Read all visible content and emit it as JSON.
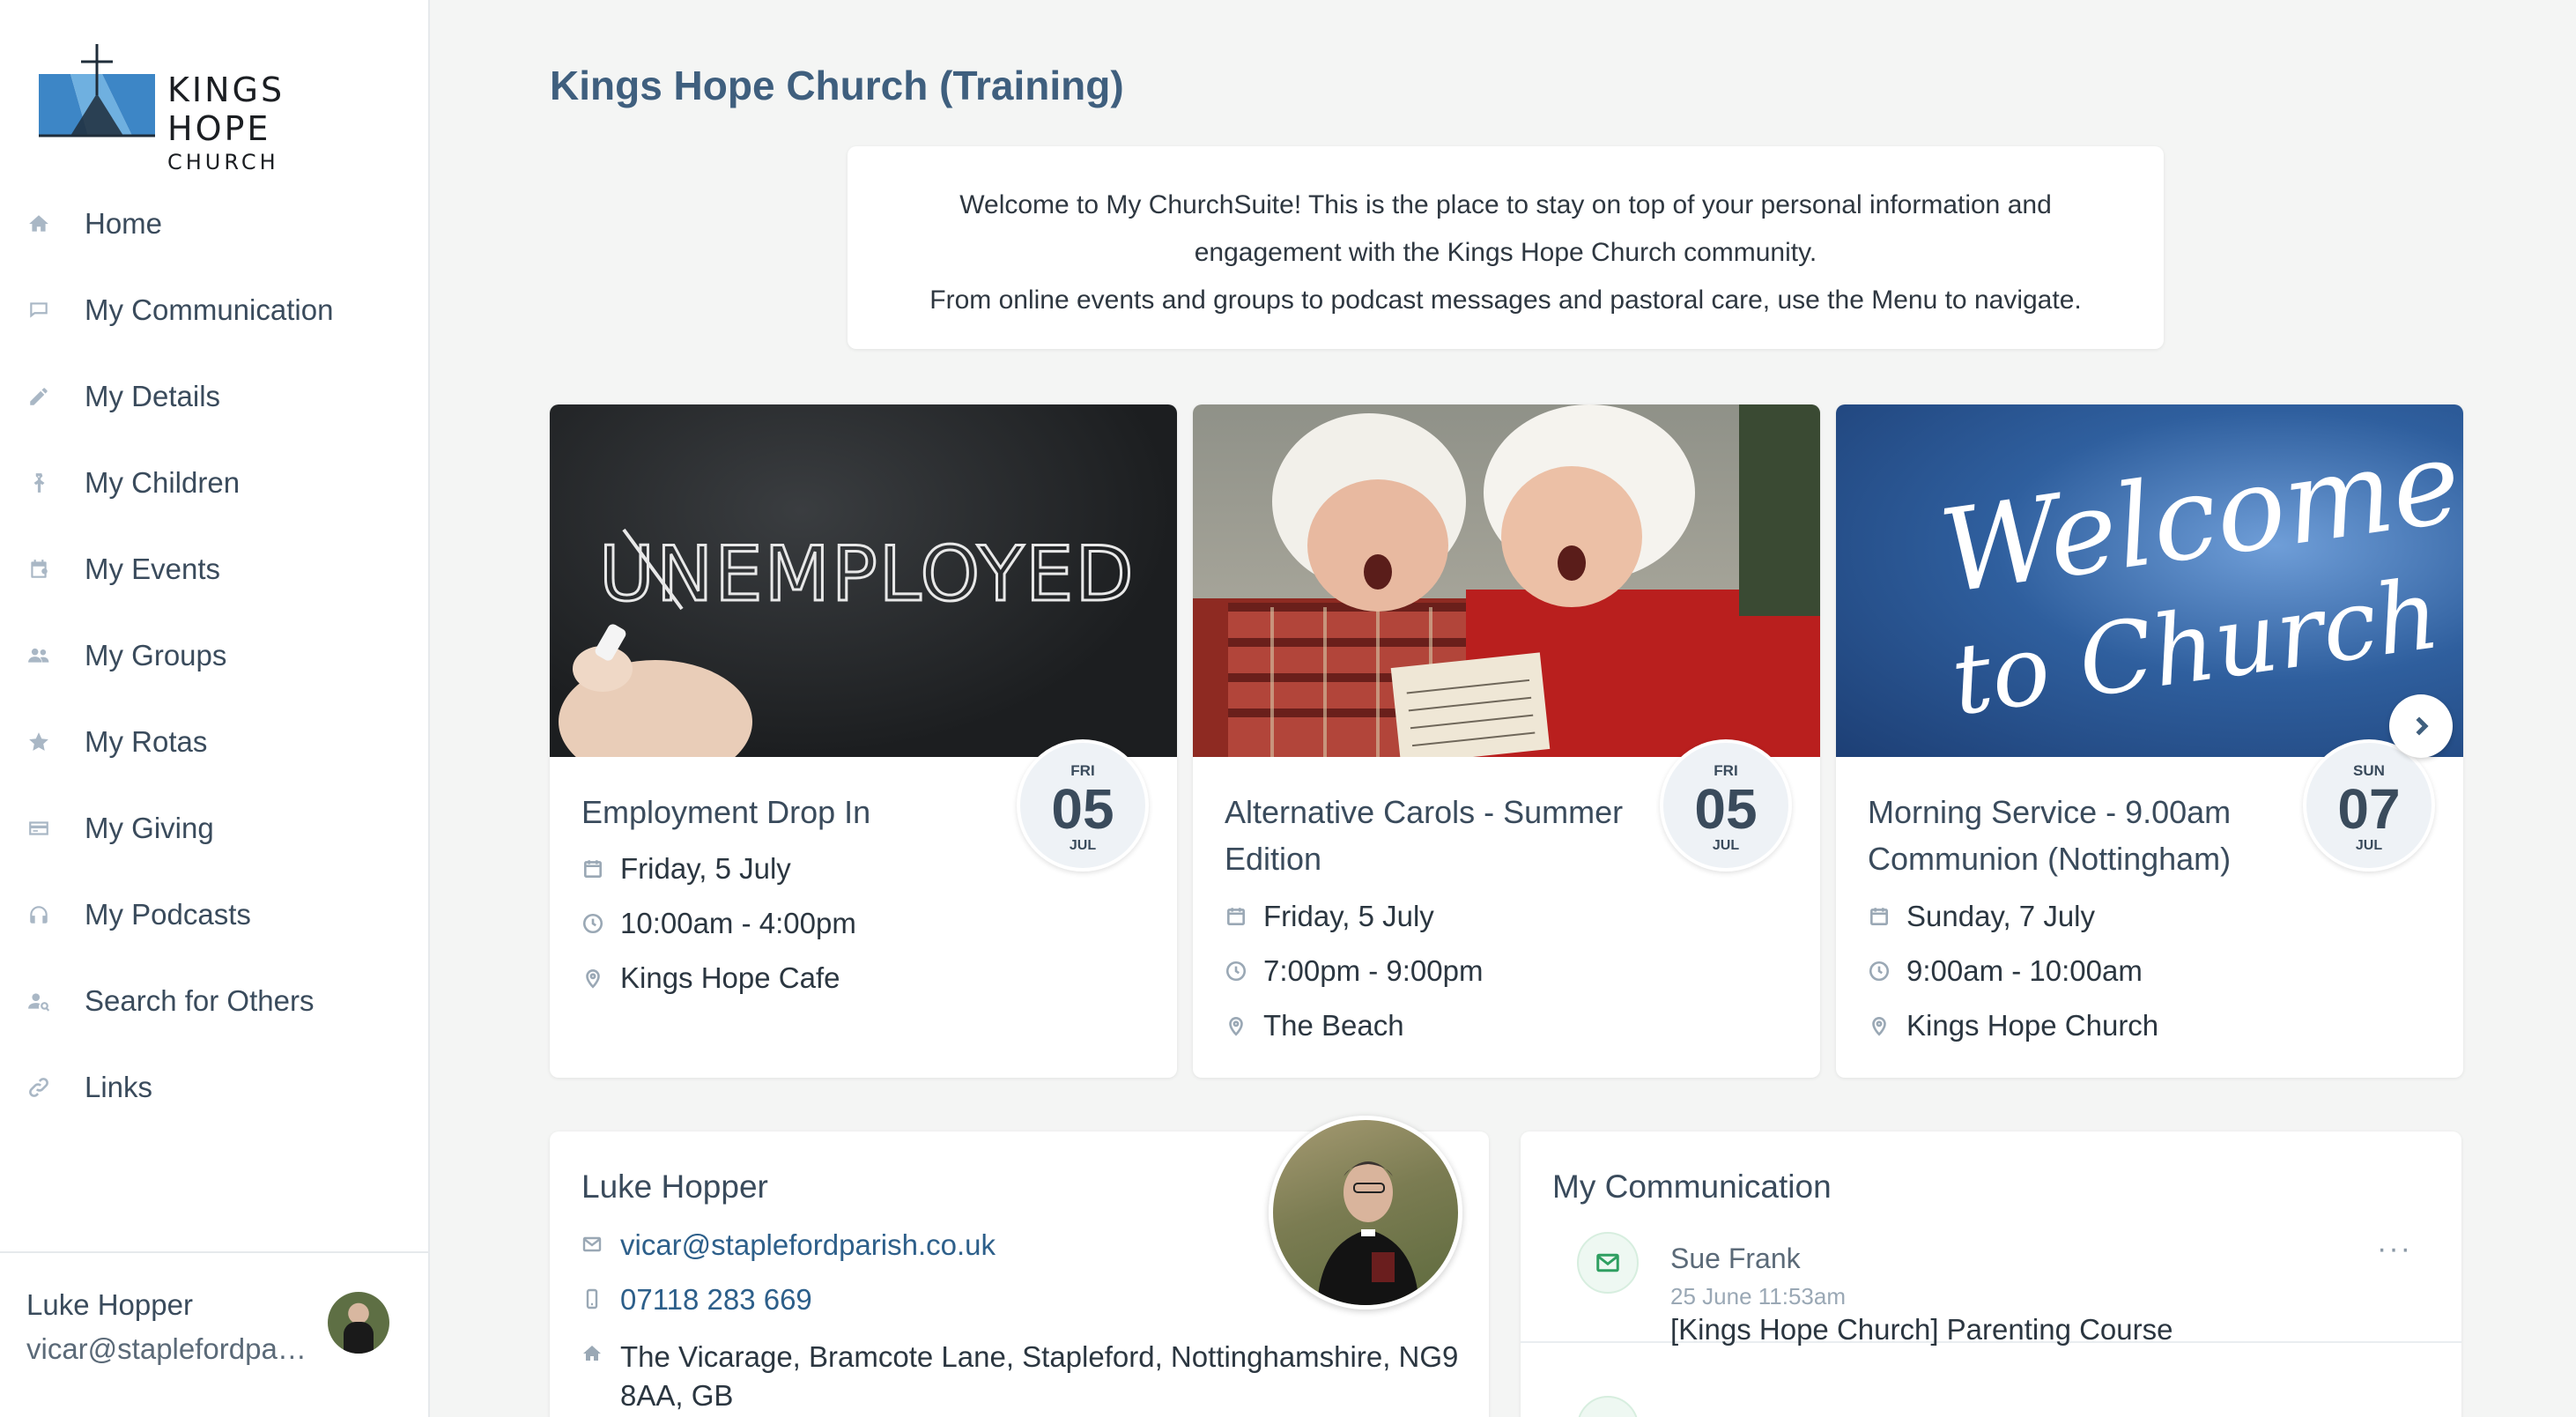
{
  "brand": {
    "name_line1": "KINGS HOPE",
    "name_line2": "CHURCH"
  },
  "sidebar": {
    "items": [
      {
        "label": "Home",
        "icon": "home-icon"
      },
      {
        "label": "My Communication",
        "icon": "chat-icon"
      },
      {
        "label": "My Details",
        "icon": "pencil-icon"
      },
      {
        "label": "My Children",
        "icon": "child-icon"
      },
      {
        "label": "My Events",
        "icon": "calendar-icon"
      },
      {
        "label": "My Groups",
        "icon": "group-icon"
      },
      {
        "label": "My Rotas",
        "icon": "star-icon"
      },
      {
        "label": "My Giving",
        "icon": "card-icon"
      },
      {
        "label": "My Podcasts",
        "icon": "headphones-icon"
      },
      {
        "label": "Search for Others",
        "icon": "people-search-icon"
      },
      {
        "label": "Links",
        "icon": "link-icon"
      }
    ],
    "user": {
      "name": "Luke Hopper",
      "email": "vicar@staplefordpar..."
    }
  },
  "page": {
    "title": "Kings Hope Church (Training)",
    "welcome": {
      "line1": "Welcome to My ChurchSuite! This is the place to stay on top of your personal information and",
      "line2": "engagement with the Kings Hope Church community.",
      "line3": "From online events and groups to podcast messages and pastoral care, use the Menu to navigate."
    }
  },
  "events": [
    {
      "title": "Employment Drop In",
      "date": "Friday, 5 July",
      "time": "10:00am - 4:00pm",
      "location": "Kings Hope Cafe",
      "badge": {
        "dow": "FRI",
        "day": "05",
        "month": "JUL"
      },
      "image_text": "UNEMPLOYED"
    },
    {
      "title": "Alternative Carols - Summer Edition",
      "date": "Friday, 5 July",
      "time": "7:00pm - 9:00pm",
      "location": "The Beach",
      "badge": {
        "dow": "FRI",
        "day": "05",
        "month": "JUL"
      }
    },
    {
      "title": "Morning Service - 9.00am Communion (Nottingham)",
      "date": "Sunday, 7 July",
      "time": "9:00am - 10:00am",
      "location": "Kings Hope Church",
      "badge": {
        "dow": "SUN",
        "day": "07",
        "month": "JUL"
      },
      "image_text_1": "Welcome",
      "image_text_2": "to Church"
    }
  ],
  "profile": {
    "name": "Luke Hopper",
    "email": "vicar@staplefordparish.co.uk",
    "phone": "07118 283 669",
    "address_line1": "The Vicarage, Bramcote Lane, Stapleford, Nottinghamshire, NG9",
    "address_line2": "8AA, GB"
  },
  "communication": {
    "title": "My Communication",
    "messages": [
      {
        "from": "Sue Frank",
        "time": "25 June 11:53am",
        "subject": "[Kings Hope Church] Parenting Course",
        "more": "···"
      }
    ]
  },
  "colors": {
    "accent": "#3f5f7e",
    "link": "#2d5f8a",
    "icon": "#a9b7c5",
    "background": "#f4f5f4",
    "success": "#2f9f61"
  }
}
